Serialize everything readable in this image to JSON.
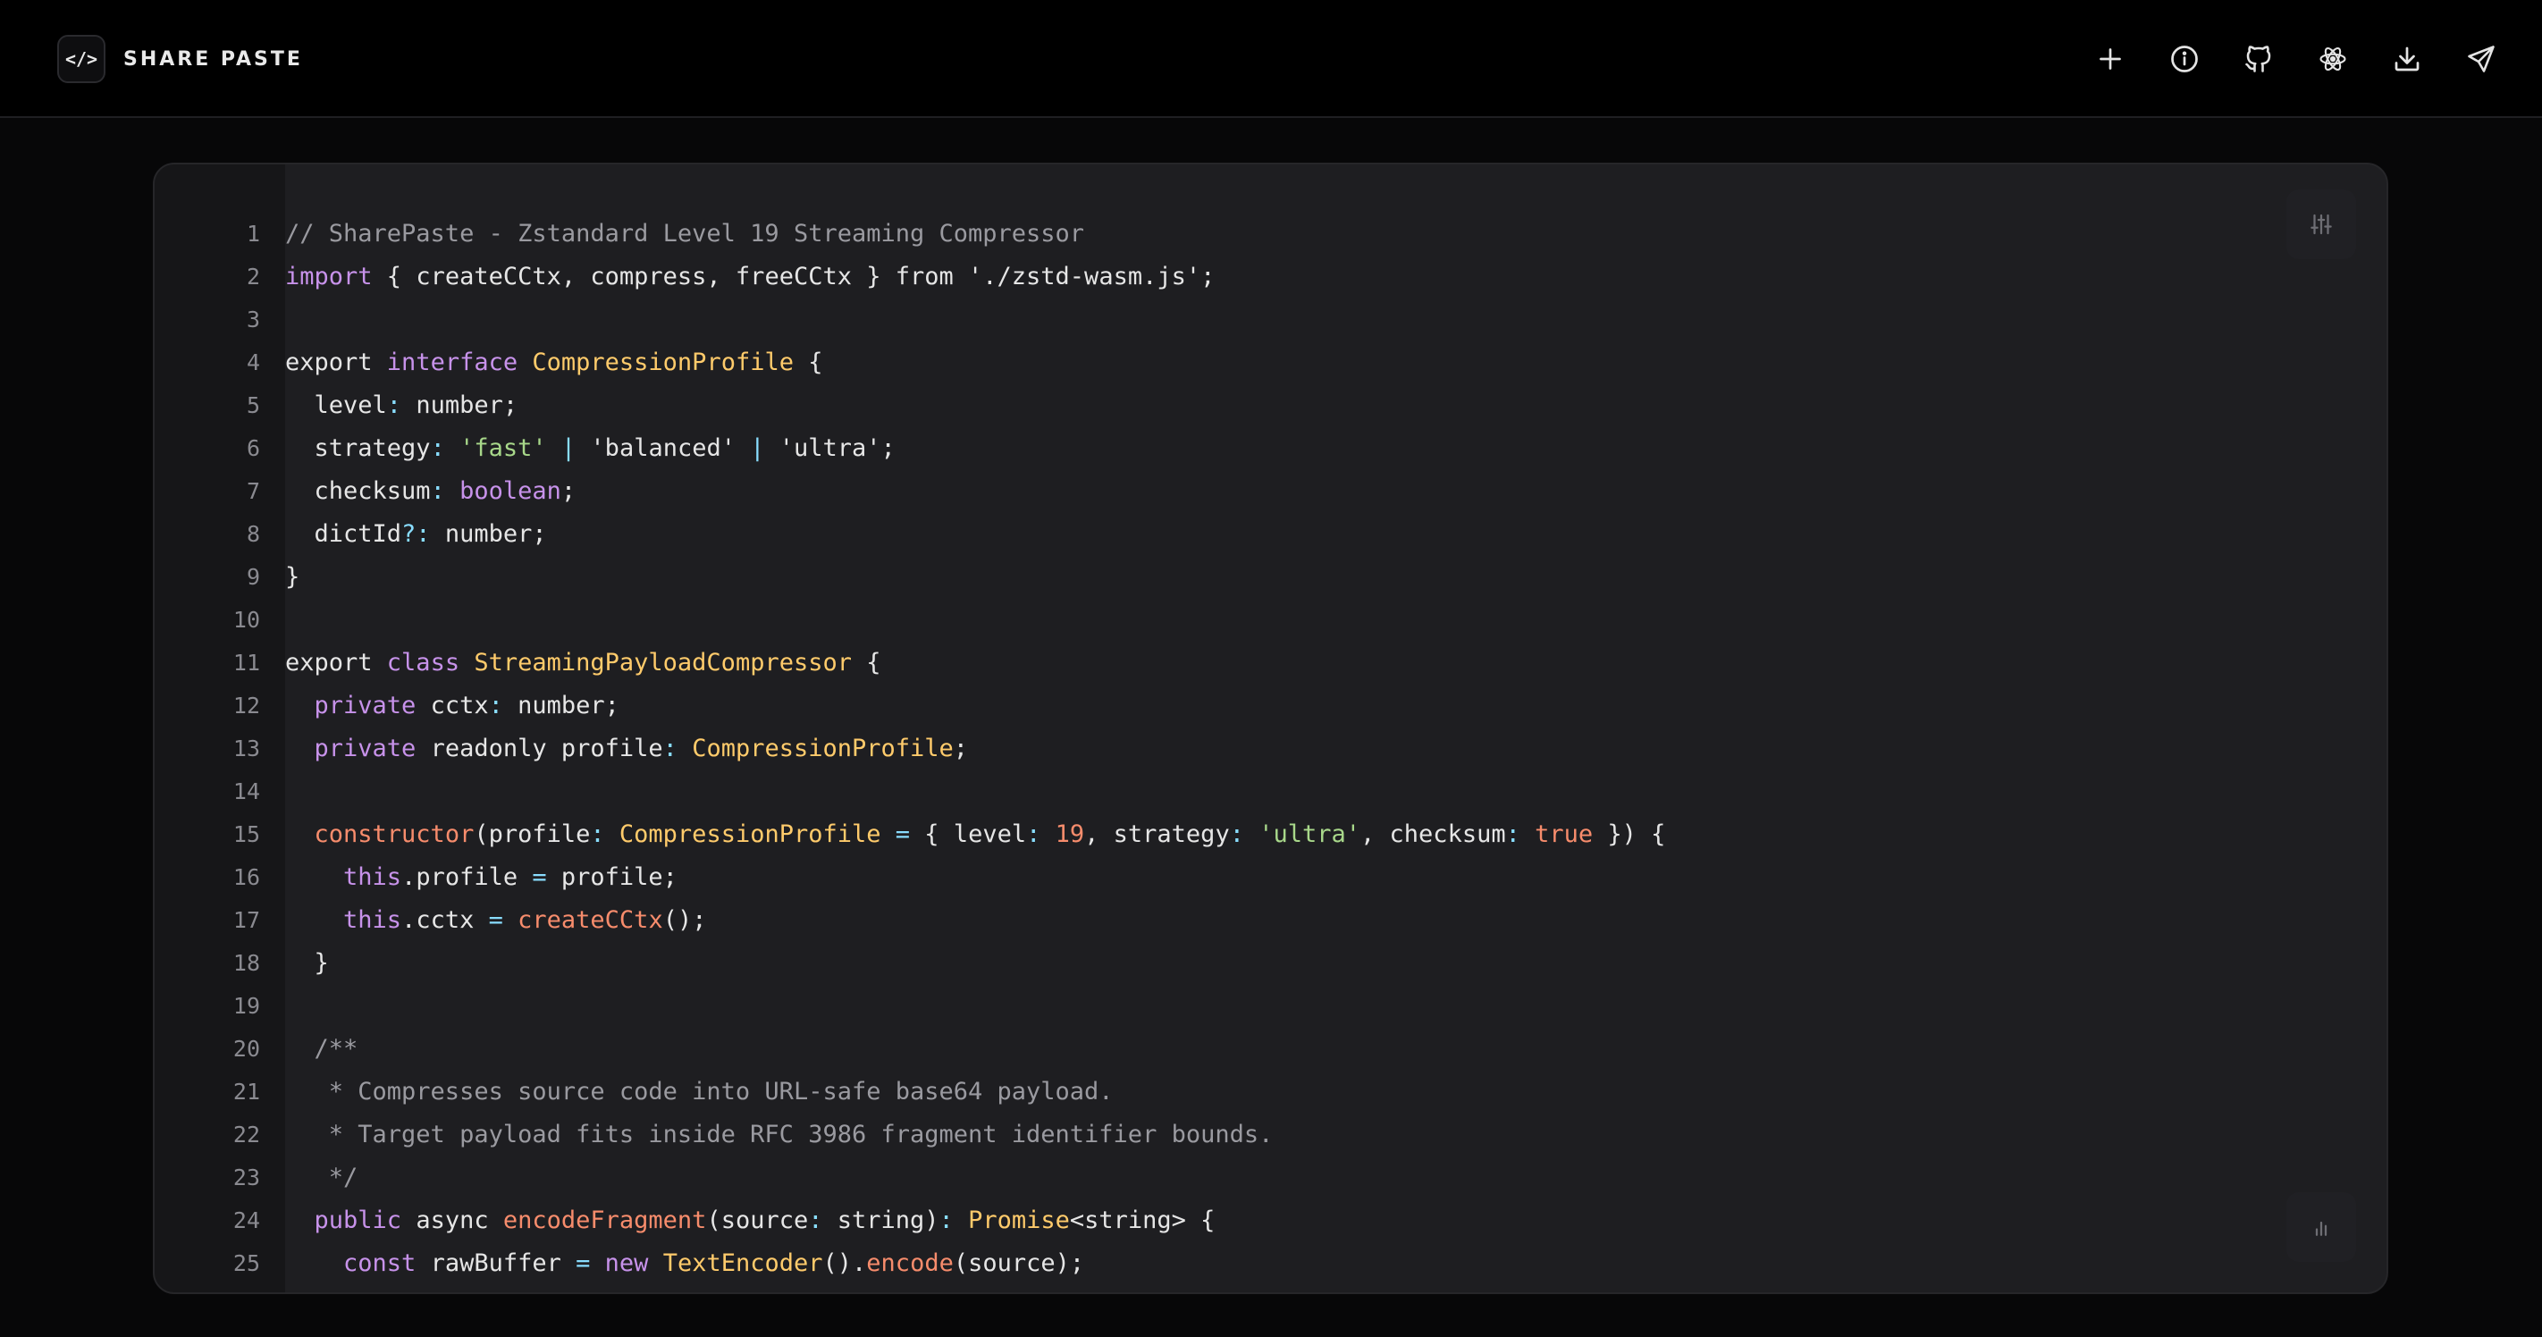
{
  "brand": {
    "logo": "</>",
    "name": "SHARE PASTE"
  },
  "header_actions": [
    {
      "icon": "plus-icon"
    },
    {
      "icon": "info-icon"
    },
    {
      "icon": "github-icon"
    },
    {
      "icon": "atom-icon"
    },
    {
      "icon": "download-icon"
    },
    {
      "icon": "send-icon"
    }
  ],
  "editor": {
    "settings_icon": "sliders-icon",
    "stats_icon": "bar-chart-icon",
    "lines": [
      {
        "n": "1",
        "tokens": [
          [
            "c",
            "// SharePaste - Zstandard Level 19 Streaming Compressor"
          ]
        ]
      },
      {
        "n": "2",
        "tokens": [
          [
            "k",
            "import"
          ],
          [
            "p",
            " { createCCtx, compress, freeCCtx } from './zstd-wasm.js';"
          ]
        ]
      },
      {
        "n": "3",
        "tokens": []
      },
      {
        "n": "4",
        "tokens": [
          [
            "p",
            "export "
          ],
          [
            "k",
            "interface"
          ],
          [
            "p",
            " "
          ],
          [
            "t",
            "CompressionProfile"
          ],
          [
            "p",
            " {"
          ]
        ]
      },
      {
        "n": "5",
        "tokens": [
          [
            "p",
            "  level"
          ],
          [
            "o",
            ":"
          ],
          [
            "p",
            " number;"
          ]
        ]
      },
      {
        "n": "6",
        "tokens": [
          [
            "p",
            "  strategy"
          ],
          [
            "o",
            ":"
          ],
          [
            "p",
            " "
          ],
          [
            "s",
            "'fast'"
          ],
          [
            "p",
            " "
          ],
          [
            "o",
            "|"
          ],
          [
            "p",
            " 'balanced' "
          ],
          [
            "o",
            "|"
          ],
          [
            "p",
            " 'ultra';"
          ]
        ]
      },
      {
        "n": "7",
        "tokens": [
          [
            "p",
            "  checksum"
          ],
          [
            "o",
            ":"
          ],
          [
            "p",
            " "
          ],
          [
            "k",
            "boolean"
          ],
          [
            "p",
            ";"
          ]
        ]
      },
      {
        "n": "8",
        "tokens": [
          [
            "p",
            "  dictId"
          ],
          [
            "o",
            "?:"
          ],
          [
            "p",
            " number;"
          ]
        ]
      },
      {
        "n": "9",
        "tokens": [
          [
            "p",
            "}"
          ]
        ]
      },
      {
        "n": "10",
        "tokens": []
      },
      {
        "n": "11",
        "tokens": [
          [
            "p",
            "export "
          ],
          [
            "k",
            "class"
          ],
          [
            "p",
            " "
          ],
          [
            "t",
            "StreamingPayloadCompressor"
          ],
          [
            "p",
            " {"
          ]
        ]
      },
      {
        "n": "12",
        "tokens": [
          [
            "p",
            "  "
          ],
          [
            "k",
            "private"
          ],
          [
            "p",
            " cctx"
          ],
          [
            "o",
            ":"
          ],
          [
            "p",
            " number;"
          ]
        ]
      },
      {
        "n": "13",
        "tokens": [
          [
            "p",
            "  "
          ],
          [
            "k",
            "private"
          ],
          [
            "p",
            " readonly profile"
          ],
          [
            "o",
            ":"
          ],
          [
            "p",
            " "
          ],
          [
            "t",
            "CompressionProfile"
          ],
          [
            "p",
            ";"
          ]
        ]
      },
      {
        "n": "14",
        "tokens": []
      },
      {
        "n": "15",
        "tokens": [
          [
            "p",
            "  "
          ],
          [
            "f",
            "constructor"
          ],
          [
            "p",
            "(profile"
          ],
          [
            "o",
            ":"
          ],
          [
            "p",
            " "
          ],
          [
            "t",
            "CompressionProfile"
          ],
          [
            "p",
            " "
          ],
          [
            "o",
            "="
          ],
          [
            "p",
            " { level"
          ],
          [
            "o",
            ":"
          ],
          [
            "p",
            " "
          ],
          [
            "n",
            "19"
          ],
          [
            "p",
            ", strategy"
          ],
          [
            "o",
            ":"
          ],
          [
            "p",
            " "
          ],
          [
            "s",
            "'ultra'"
          ],
          [
            "p",
            ", checksum"
          ],
          [
            "o",
            ":"
          ],
          [
            "p",
            " "
          ],
          [
            "l",
            "true"
          ],
          [
            "p",
            " }) {"
          ]
        ]
      },
      {
        "n": "16",
        "tokens": [
          [
            "p",
            "    "
          ],
          [
            "k",
            "this"
          ],
          [
            "p",
            ".profile "
          ],
          [
            "o",
            "="
          ],
          [
            "p",
            " profile;"
          ]
        ]
      },
      {
        "n": "17",
        "tokens": [
          [
            "p",
            "    "
          ],
          [
            "k",
            "this"
          ],
          [
            "p",
            ".cctx "
          ],
          [
            "o",
            "="
          ],
          [
            "p",
            " "
          ],
          [
            "f",
            "createCCtx"
          ],
          [
            "p",
            "();"
          ]
        ]
      },
      {
        "n": "18",
        "tokens": [
          [
            "p",
            "  }"
          ]
        ]
      },
      {
        "n": "19",
        "tokens": []
      },
      {
        "n": "20",
        "tokens": [
          [
            "c",
            "  /**"
          ]
        ]
      },
      {
        "n": "21",
        "tokens": [
          [
            "c",
            "   * Compresses source code into URL-safe base64 payload."
          ]
        ]
      },
      {
        "n": "22",
        "tokens": [
          [
            "c",
            "   * Target payload fits inside RFC 3986 fragment identifier bounds."
          ]
        ]
      },
      {
        "n": "23",
        "tokens": [
          [
            "c",
            "   */"
          ]
        ]
      },
      {
        "n": "24",
        "tokens": [
          [
            "p",
            "  "
          ],
          [
            "k",
            "public"
          ],
          [
            "p",
            " async "
          ],
          [
            "f",
            "encodeFragment"
          ],
          [
            "p",
            "(source"
          ],
          [
            "o",
            ":"
          ],
          [
            "p",
            " string)"
          ],
          [
            "o",
            ":"
          ],
          [
            "p",
            " "
          ],
          [
            "t",
            "Promise"
          ],
          [
            "p",
            "<string> {"
          ]
        ]
      },
      {
        "n": "25",
        "tokens": [
          [
            "p",
            "    "
          ],
          [
            "k",
            "const"
          ],
          [
            "p",
            " rawBuffer "
          ],
          [
            "o",
            "="
          ],
          [
            "p",
            " "
          ],
          [
            "k",
            "new"
          ],
          [
            "p",
            " "
          ],
          [
            "t",
            "TextEncoder"
          ],
          [
            "p",
            "()."
          ],
          [
            "f",
            "encode"
          ],
          [
            "p",
            "(source);"
          ]
        ]
      }
    ]
  }
}
